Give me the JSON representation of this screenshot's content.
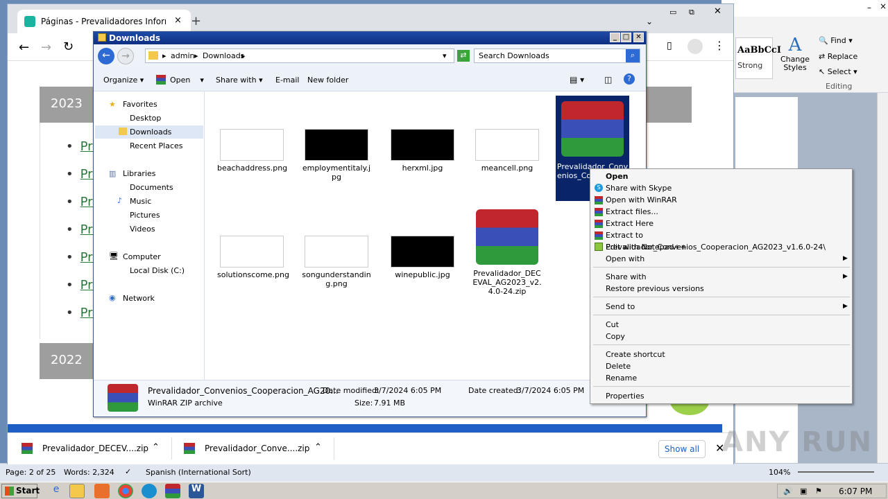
{
  "chrome": {
    "tab_title": "Páginas - Prevalidadores Informacion",
    "years": [
      "2023",
      "2022"
    ],
    "link_prefix": "Pre",
    "downloads": [
      {
        "name": "Prevalidador_DECEV....zip"
      },
      {
        "name": "Prevalidador_Conve....zip"
      }
    ],
    "show_all": "Show all"
  },
  "word": {
    "styles_preview": "AaBbCcI",
    "strong_label": "Strong",
    "change_styles": "Change Styles",
    "find": "Find",
    "replace": "Replace",
    "select": "Select",
    "editing": "Editing",
    "status": {
      "page": "Page: 2 of 25",
      "words": "Words: 2,324",
      "language": "Spanish (International Sort)",
      "zoom": "104%"
    }
  },
  "explorer": {
    "title": "Downloads",
    "breadcrumb": [
      "admin",
      "Downloads"
    ],
    "search_placeholder": "Search Downloads",
    "commands": [
      "Organize",
      "Open",
      "Share with",
      "E-mail",
      "New folder"
    ],
    "nav": {
      "favorites": "Favorites",
      "favorites_items": [
        "Desktop",
        "Downloads",
        "Recent Places"
      ],
      "libraries": "Libraries",
      "libraries_items": [
        "Documents",
        "Music",
        "Pictures",
        "Videos"
      ],
      "computer": "Computer",
      "computer_items": [
        "Local Disk (C:)"
      ],
      "network": "Network"
    },
    "files": [
      {
        "name": "beachaddress.png",
        "thumb": "white"
      },
      {
        "name": "employmentitaly.jpg",
        "thumb": "black"
      },
      {
        "name": "herxml.jpg",
        "thumb": "black"
      },
      {
        "name": "meancell.png",
        "thumb": "white"
      },
      {
        "name": "Prevalidador_Convenios_Cooperacion_AG2023_v1.6.0-24.zip",
        "label": "Prevalidador_Conv enios_Co _AG2023 4",
        "thumb": "winrar"
      },
      {
        "name": "solutionscome.png",
        "thumb": "white"
      },
      {
        "name": "songunderstanding.png",
        "thumb": "white"
      },
      {
        "name": "winepublic.jpg",
        "thumb": "black"
      },
      {
        "name": "Prevalidador_DECEVAL_AG2023_v2.4.0-24.zip",
        "thumb": "winrar"
      }
    ],
    "details": {
      "name": "Prevalidador_Convenios_Cooperacion_AG20...",
      "type": "WinRAR ZIP archive",
      "modified_label": "Date modified:",
      "modified": "3/7/2024 6:05 PM",
      "created_label": "Date created:",
      "created": "3/7/2024 6:05 PM",
      "size_label": "Size:",
      "size": "7.91 MB"
    }
  },
  "context_menu": {
    "items": [
      "Open",
      "Share with Skype",
      "Open with WinRAR",
      "Extract files...",
      "Extract Here",
      "Extract to Prevalidador_Convenios_Cooperacion_AG2023_v1.6.0-24\\",
      "Edit with Notepad++",
      "Open with",
      "Share with",
      "Restore previous versions",
      "Send to",
      "Cut",
      "Copy",
      "Create shortcut",
      "Delete",
      "Rename",
      "Properties"
    ]
  },
  "taskbar": {
    "start": "Start",
    "clock": "6:07 PM"
  },
  "watermark": "ANY RUN",
  "colors": {
    "title_blue": "#0d2f82",
    "link_green": "#2b7a3b",
    "selection": "#0a246a"
  }
}
